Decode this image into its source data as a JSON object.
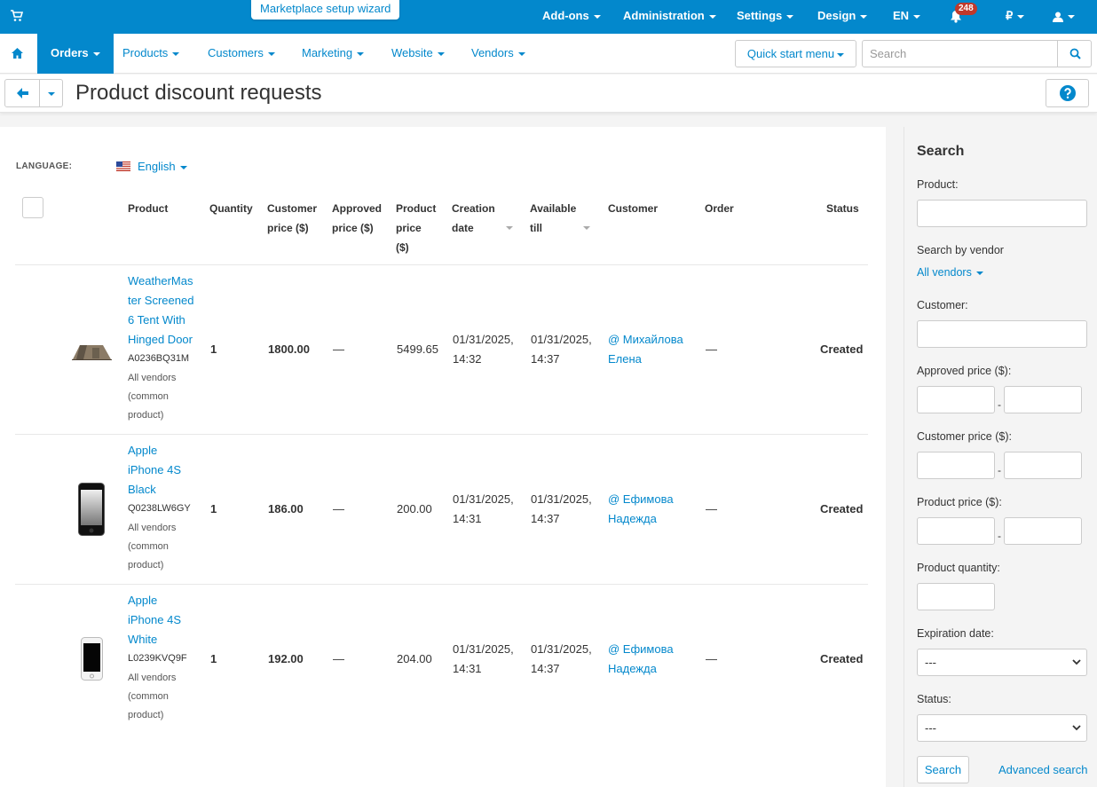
{
  "topbar": {
    "wizard": "Marketplace setup wizard",
    "menu": [
      {
        "label": "Add-ons",
        "name": "topnav-addons"
      },
      {
        "label": "Administration",
        "name": "topnav-administration"
      },
      {
        "label": "Settings",
        "name": "topnav-settings"
      },
      {
        "label": "Design",
        "name": "topnav-design"
      },
      {
        "label": "EN",
        "name": "topnav-language"
      }
    ],
    "notifications": "248",
    "currency": "₽"
  },
  "nav": {
    "items": [
      "Orders",
      "Products",
      "Customers",
      "Marketing",
      "Website",
      "Vendors"
    ],
    "quick_start": "Quick start menu",
    "search_placeholder": "Search"
  },
  "page": {
    "title": "Product discount requests"
  },
  "main": {
    "language_label": "LANGUAGE:",
    "language_value": "English",
    "columns": {
      "product": "Product",
      "quantity": "Quantity",
      "customer_price": [
        "Customer",
        "price ($)"
      ],
      "approved_price": [
        "Approved",
        "price ($)"
      ],
      "product_price": [
        "Product",
        "price",
        "($)"
      ],
      "creation_date": [
        "Creation",
        "date"
      ],
      "available_till": [
        "Available",
        "till"
      ],
      "customer": "Customer",
      "order": "Order",
      "status": "Status"
    },
    "rows": [
      {
        "name_lines": [
          "WeatherMas",
          "ter Screened",
          "6 Tent With",
          "Hinged Door"
        ],
        "code": "A0236BQ31M",
        "vendor_lines": [
          "All vendors",
          "(common",
          "product)"
        ],
        "quantity": "1",
        "customer_price": "1800.00",
        "approved_price": "—",
        "product_price": "5499.65",
        "created": [
          "01/31/2025,",
          "14:32"
        ],
        "available": [
          "01/31/2025,",
          "14:37"
        ],
        "customer": [
          "@ Михайлова",
          "Елена"
        ],
        "order": "—",
        "status": "Created",
        "image": "tent"
      },
      {
        "name_lines": [
          "Apple",
          "iPhone 4S",
          "Black"
        ],
        "code": "Q0238LW6GY",
        "vendor_lines": [
          "All vendors",
          "(common",
          "product)"
        ],
        "quantity": "1",
        "customer_price": "186.00",
        "approved_price": "—",
        "product_price": "200.00",
        "created": [
          "01/31/2025,",
          "14:31"
        ],
        "available": [
          "01/31/2025,",
          "14:37"
        ],
        "customer": [
          "@ Ефимова",
          "Надежда"
        ],
        "order": "—",
        "status": "Created",
        "image": "iphone-black"
      },
      {
        "name_lines": [
          "Apple",
          "iPhone 4S",
          "White"
        ],
        "code": "L0239KVQ9F",
        "vendor_lines": [
          "All vendors",
          "(common",
          "product)"
        ],
        "quantity": "1",
        "customer_price": "192.00",
        "approved_price": "—",
        "product_price": "204.00",
        "created": [
          "01/31/2025,",
          "14:31"
        ],
        "available": [
          "01/31/2025,",
          "14:37"
        ],
        "customer": [
          "@ Ефимова",
          "Надежда"
        ],
        "order": "—",
        "status": "Created",
        "image": "iphone-white"
      }
    ]
  },
  "sidebar": {
    "title": "Search",
    "product_label": "Product:",
    "vendor_label": "Search by vendor",
    "vendor_value": "All vendors",
    "customer_label": "Customer:",
    "approved_label": "Approved price ($):",
    "customer_price_label": "Customer price ($):",
    "product_price_label": "Product price ($):",
    "quantity_label": "Product quantity:",
    "expiration_label": "Expiration date:",
    "expiration_value": "---",
    "status_label": "Status:",
    "status_value": "---",
    "range_dash": "-",
    "search_button": "Search",
    "advanced": "Advanced search"
  },
  "colors": {
    "accent": "#0388cc",
    "badge": "#c0392b"
  }
}
